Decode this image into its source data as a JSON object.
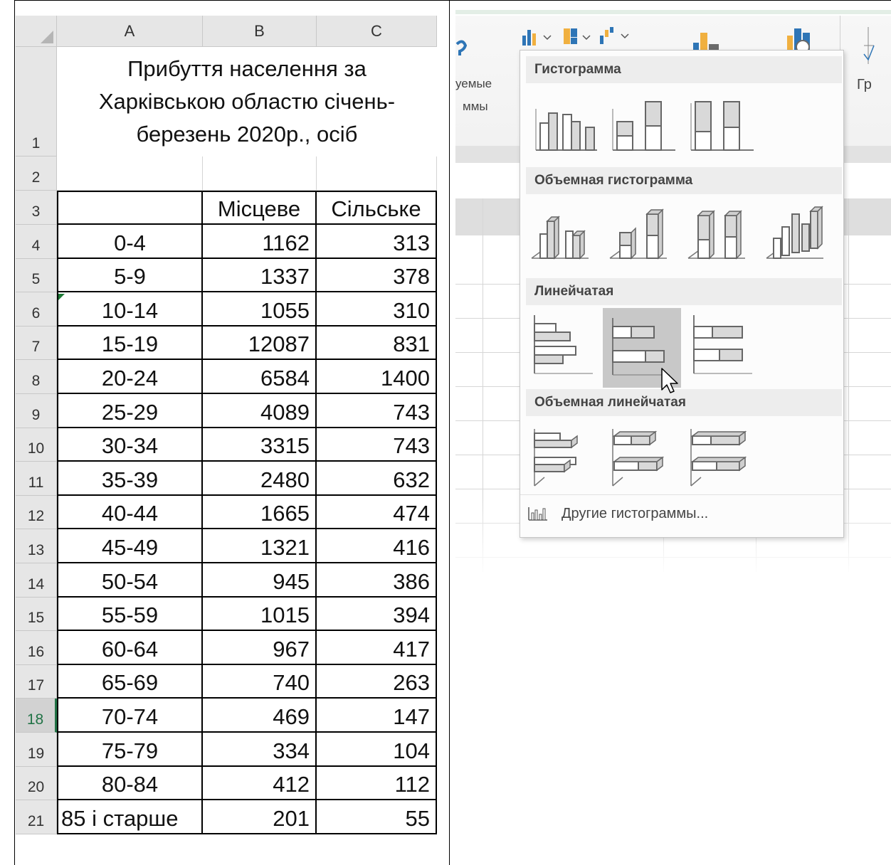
{
  "spreadsheet": {
    "column_headers": [
      "A",
      "B",
      "C"
    ],
    "title": "Прибуття населення за Харківською областю січень-березень 2020р., осіб",
    "title_lines": [
      "Прибуття населення за",
      "Харківською областю січень-",
      "березень 2020р., осіб"
    ],
    "header_row": {
      "a": "",
      "b": "Місцеве",
      "c": "Сільське"
    },
    "rows": [
      {
        "num": "1"
      },
      {
        "num": "2"
      },
      {
        "num": "3"
      },
      {
        "num": "4",
        "a": "0-4",
        "b": "1162",
        "c": "313"
      },
      {
        "num": "5",
        "a": "5-9",
        "b": "1337",
        "c": "378"
      },
      {
        "num": "6",
        "a": "10-14",
        "b": "1055",
        "c": "310"
      },
      {
        "num": "7",
        "a": "15-19",
        "b": "12087",
        "c": "831"
      },
      {
        "num": "8",
        "a": "20-24",
        "b": "6584",
        "c": "1400"
      },
      {
        "num": "9",
        "a": "25-29",
        "b": "4089",
        "c": "743"
      },
      {
        "num": "10",
        "a": "30-34",
        "b": "3315",
        "c": "743"
      },
      {
        "num": "11",
        "a": "35-39",
        "b": "2480",
        "c": "632"
      },
      {
        "num": "12",
        "a": "40-44",
        "b": "1665",
        "c": "474"
      },
      {
        "num": "13",
        "a": "45-49",
        "b": "1321",
        "c": "416"
      },
      {
        "num": "14",
        "a": "50-54",
        "b": "945",
        "c": "386"
      },
      {
        "num": "15",
        "a": "55-59",
        "b": "1015",
        "c": "394"
      },
      {
        "num": "16",
        "a": "60-64",
        "b": "967",
        "c": "417"
      },
      {
        "num": "17",
        "a": "65-69",
        "b": "740",
        "c": "263"
      },
      {
        "num": "18",
        "a": "70-74",
        "b": "469",
        "c": "147"
      },
      {
        "num": "19",
        "a": "75-79",
        "b": "334",
        "c": "104"
      },
      {
        "num": "20",
        "a": "80-84",
        "b": "412",
        "c": "112"
      },
      {
        "num": "21",
        "a": "85 і старше",
        "b": "201",
        "c": "55"
      }
    ],
    "selected_row": "18"
  },
  "ribbon": {
    "partial_text_1": "уемые",
    "partial_text_2": "ммы",
    "partial_text_3": "Гр"
  },
  "chart_menu": {
    "sections": [
      "Гистограмма",
      "Объемная гистограмма",
      "Линейчатая",
      "Объемная линейчатая"
    ],
    "more_charts": "Другие гистограммы...",
    "hovered_item": "Линейчатая — с накоплением"
  },
  "colors": {
    "accent_green": "#217346",
    "chart_blue": "#2e75b6",
    "chart_orange": "#f0b040",
    "hover_gray": "#c8c8c8"
  }
}
